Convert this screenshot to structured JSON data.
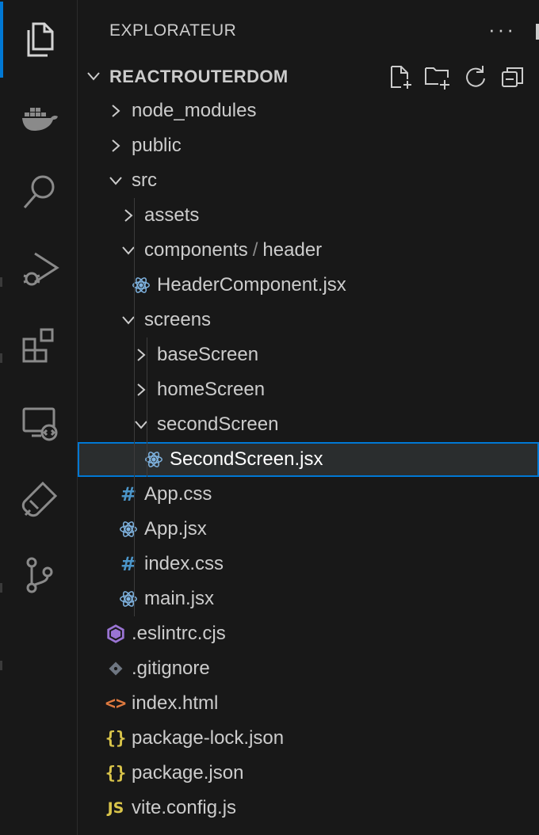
{
  "explorer": {
    "title": "EXPLORATEUR",
    "more_label": "···",
    "root_label": "REACTROUTERDOM"
  },
  "activity_icons": [
    "files-icon",
    "docker-icon",
    "search-icon",
    "run-debug-icon",
    "extensions-icon",
    "remote-explorer-icon",
    "testing-icon",
    "source-control-icon"
  ],
  "colors": {
    "accent": "#0078d4",
    "react": "#7fb3e0",
    "css": "#4b95c9",
    "eslint": "#9a74d3",
    "git": "#6e7681",
    "html": "#e07a3f",
    "json": "#d9c44a",
    "js": "#d9c44a"
  },
  "tree": [
    {
      "label": "node_modules",
      "type": "folder",
      "open": false
    },
    {
      "label": "public",
      "type": "folder",
      "open": false
    },
    {
      "label": "src",
      "type": "folder",
      "open": true
    },
    {
      "label": "assets",
      "type": "folder",
      "open": false
    },
    {
      "label": "components",
      "label2": "header",
      "type": "folder",
      "open": true
    },
    {
      "label": "HeaderComponent.jsx",
      "type": "react"
    },
    {
      "label": "screens",
      "type": "folder",
      "open": true
    },
    {
      "label": "baseScreen",
      "type": "folder",
      "open": false
    },
    {
      "label": "homeScreen",
      "type": "folder",
      "open": false
    },
    {
      "label": "secondScreen",
      "type": "folder",
      "open": true
    },
    {
      "label": "SecondScreen.jsx",
      "type": "react",
      "selected": true
    },
    {
      "label": "App.css",
      "type": "css"
    },
    {
      "label": "App.jsx",
      "type": "react"
    },
    {
      "label": "index.css",
      "type": "css"
    },
    {
      "label": "main.jsx",
      "type": "react"
    },
    {
      "label": ".eslintrc.cjs",
      "type": "eslint"
    },
    {
      "label": ".gitignore",
      "type": "git"
    },
    {
      "label": "index.html",
      "type": "html"
    },
    {
      "label": "package-lock.json",
      "type": "json"
    },
    {
      "label": "package.json",
      "type": "json"
    },
    {
      "label": "vite.config.js",
      "type": "js"
    }
  ]
}
